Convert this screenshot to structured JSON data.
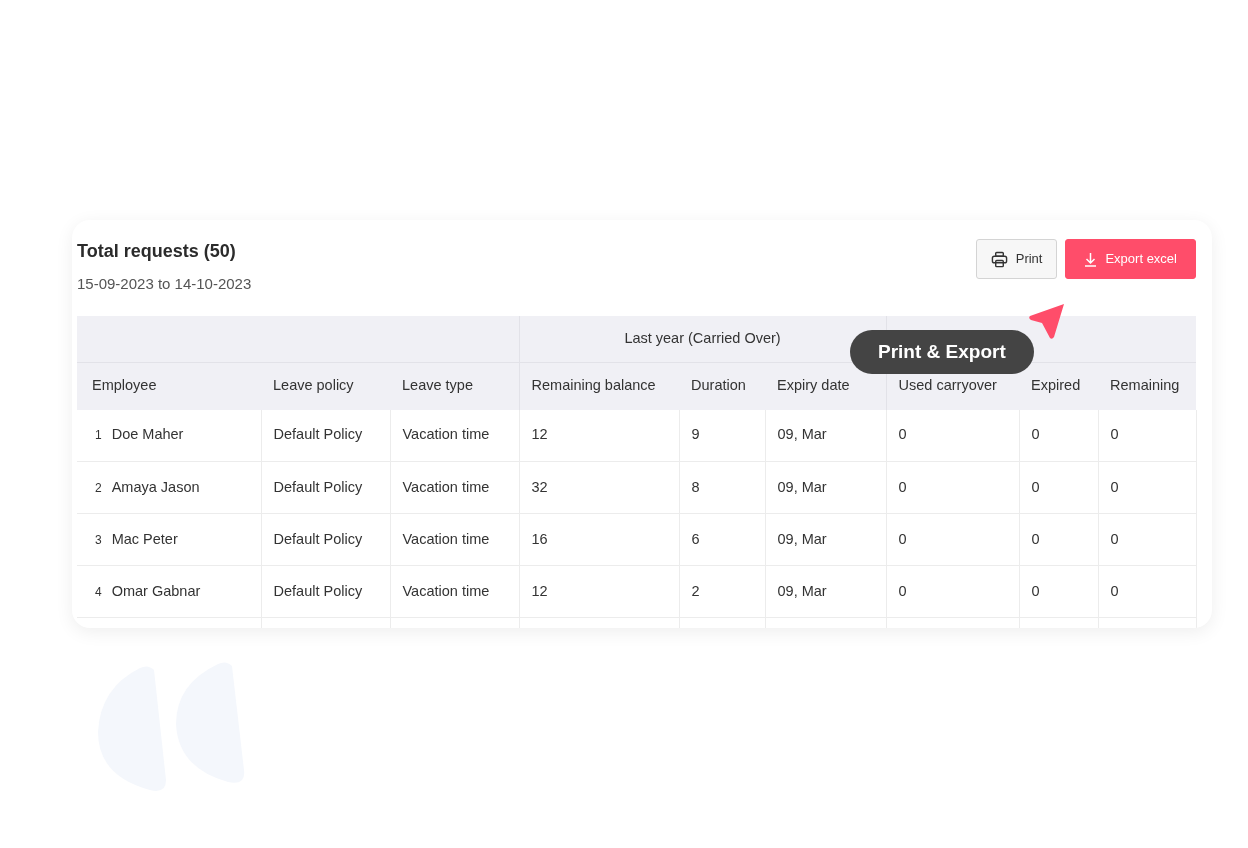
{
  "card": {
    "title": "Total requests (50)",
    "date_range": "15-09-2023 to 14-10-2023",
    "buttons": [
      {
        "kind": "print",
        "label": "Print"
      },
      {
        "kind": "export",
        "label": "Export excel"
      }
    ]
  },
  "table": {
    "column_groups": [
      {
        "columns": [
          "Employee",
          "Leave policy",
          "Leave type"
        ]
      },
      {
        "label": "Last year (Carried Over)",
        "columns": [
          "Remaining balance",
          "Duration",
          "Expiry date"
        ]
      },
      {
        "columns": [
          "Used carryover",
          "Expired",
          "Remaining"
        ]
      }
    ],
    "rows": [
      {
        "index": "1",
        "employee": "Doe Maher",
        "cells": [
          "Default Policy",
          "Vacation time",
          "12",
          "9",
          "09, Mar",
          "0",
          "0",
          "0"
        ]
      },
      {
        "index": "2",
        "employee": "Amaya Jason",
        "cells": [
          "Default Policy",
          "Vacation time",
          "32",
          "8",
          "09, Mar",
          "0",
          "0",
          "0"
        ]
      },
      {
        "index": "3",
        "employee": "Mac Peter",
        "cells": [
          "Default Policy",
          "Vacation time",
          "16",
          "6",
          "09, Mar",
          "0",
          "0",
          "0"
        ]
      },
      {
        "index": "4",
        "employee": "Omar Gabnar",
        "cells": [
          "Default Policy",
          "Vacation time",
          "12",
          "2",
          "09, Mar",
          "0",
          "0",
          "0"
        ]
      }
    ]
  },
  "tooltip": {
    "label": "Print & Export"
  }
}
